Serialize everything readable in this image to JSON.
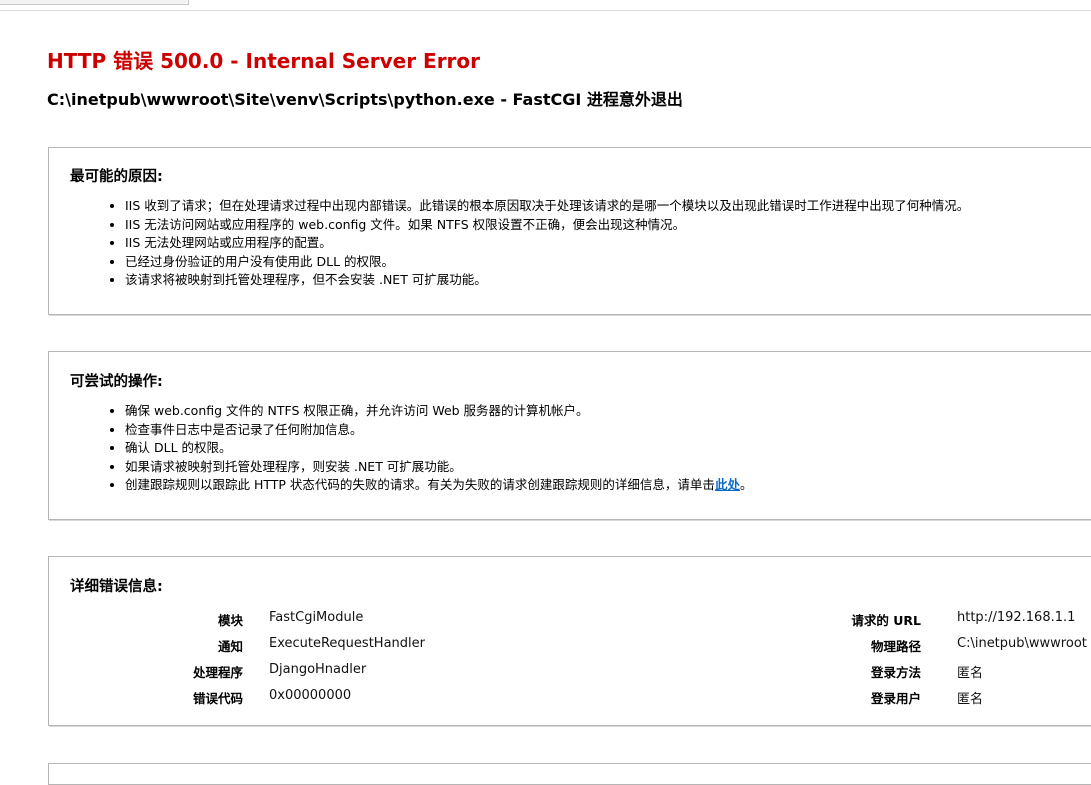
{
  "header": {
    "title": "HTTP 错误 500.0 - Internal Server Error",
    "subtitle": "C:\\inetpub\\wwwroot\\Site\\venv\\Scripts\\python.exe - FastCGI 进程意外退出"
  },
  "causes": {
    "heading": "最可能的原因:",
    "items": [
      "IIS 收到了请求；但在处理请求过程中出现内部错误。此错误的根本原因取决于处理该请求的是哪一个模块以及出现此错误时工作进程中出现了何种情况。",
      "IIS 无法访问网站或应用程序的 web.config 文件。如果 NTFS 权限设置不正确，便会出现这种情况。",
      "IIS 无法处理网站或应用程序的配置。",
      "已经过身份验证的用户没有使用此 DLL 的权限。",
      "该请求将被映射到托管处理程序，但不会安装 .NET 可扩展功能。"
    ]
  },
  "actions": {
    "heading": "可尝试的操作:",
    "items": [
      "确保 web.config 文件的 NTFS 权限正确，并允许访问 Web 服务器的计算机帐户。",
      "检查事件日志中是否记录了任何附加信息。",
      "确认 DLL 的权限。",
      "如果请求被映射到托管处理程序，则安装 .NET 可扩展功能。"
    ],
    "last_item_text": "创建跟踪规则以跟踪此 HTTP 状态代码的失败的请求。有关为失败的请求创建跟踪规则的详细信息，请单击",
    "last_item_link": "此处",
    "last_item_suffix": "。"
  },
  "details": {
    "heading": "详细错误信息:",
    "left": [
      {
        "label": "模块",
        "value": "FastCgiModule"
      },
      {
        "label": "通知",
        "value": "ExecuteRequestHandler"
      },
      {
        "label": "处理程序",
        "value": "DjangoHnadler"
      },
      {
        "label": "错误代码",
        "value": "0x00000000"
      }
    ],
    "right": [
      {
        "label": "请求的 URL",
        "value": "http://192.168.1.1"
      },
      {
        "label": "物理路径",
        "value": "C:\\inetpub\\wwwroot"
      },
      {
        "label": "登录方法",
        "value": "匿名"
      },
      {
        "label": "登录用户",
        "value": "匿名"
      }
    ]
  },
  "colors": {
    "title": "#cc0000",
    "link": "#0b68c9",
    "panel_border": "#b5b5b5"
  }
}
